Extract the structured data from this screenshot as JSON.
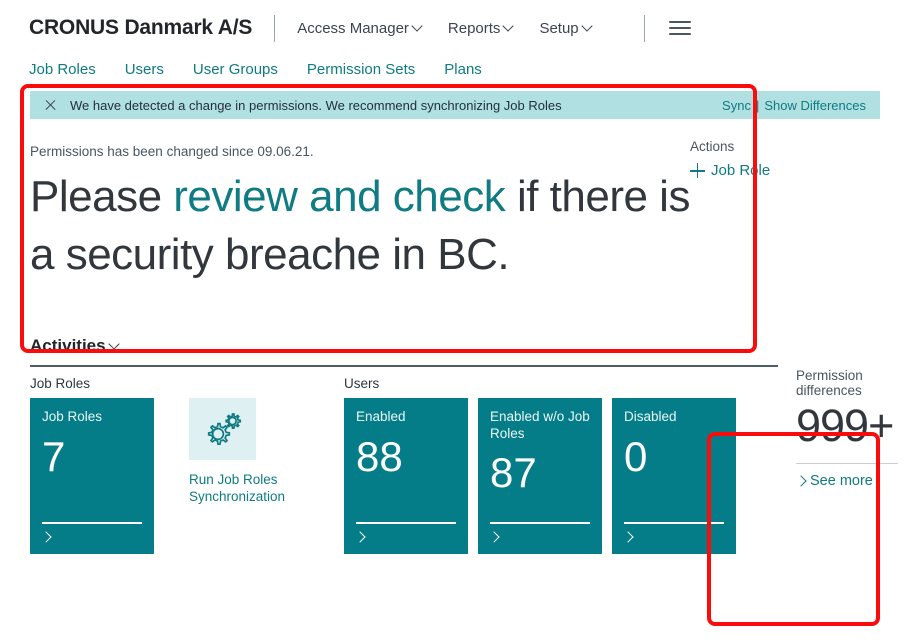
{
  "header": {
    "company": "CRONUS Danmark A/S",
    "nav": [
      {
        "label": "Access Manager",
        "has_chevron": true
      },
      {
        "label": "Reports",
        "has_chevron": true
      },
      {
        "label": "Setup",
        "has_chevron": true
      }
    ],
    "menu_icon": "hamburger-icon"
  },
  "subnav": {
    "items": [
      {
        "label": "Job Roles"
      },
      {
        "label": "Users"
      },
      {
        "label": "User Groups"
      },
      {
        "label": "Permission Sets"
      },
      {
        "label": "Plans"
      }
    ]
  },
  "notification": {
    "close_icon": "close-icon",
    "message": "We have detected a change in permissions. We recommend synchronizing Job Roles",
    "sync_label": "Sync",
    "separator": "|",
    "show_differences_label": "Show Differences",
    "background_color": "#b0e0e2"
  },
  "main": {
    "subtitle": "Permissions has been changed since 09.06.21.",
    "headline_part1": "Please ",
    "headline_accent": "review and check",
    "headline_part2": " if there is a security breache in BC.",
    "accent_color": "#0f7b82"
  },
  "actions": {
    "title": "Actions",
    "items": [
      {
        "label": "Job Role",
        "icon": "plus-icon"
      }
    ]
  },
  "activities": {
    "title": "Activities",
    "chevron_icon": "chevron-down-icon",
    "groups": [
      {
        "title": "Job Roles",
        "tiles": [
          {
            "label": "Job Roles",
            "value": "7"
          }
        ],
        "action": {
          "icon": "gears-icon",
          "label": "Run Job Roles Synchronization"
        }
      },
      {
        "title": "Users",
        "tiles": [
          {
            "label": "Enabled",
            "value": "88"
          },
          {
            "label": "Enabled w/o Job Roles",
            "value": "87"
          },
          {
            "label": "Disabled",
            "value": "0"
          }
        ]
      }
    ],
    "tile_color": "#047d88"
  },
  "permission_card": {
    "title": "Permission differences",
    "value": "999+",
    "see_more_label": "See more",
    "chevron_icon": "chevron-right-icon"
  },
  "annotations": {
    "color": "#fb0c0c",
    "boxes": [
      "main-message-highlight",
      "permission-differences-highlight"
    ]
  }
}
